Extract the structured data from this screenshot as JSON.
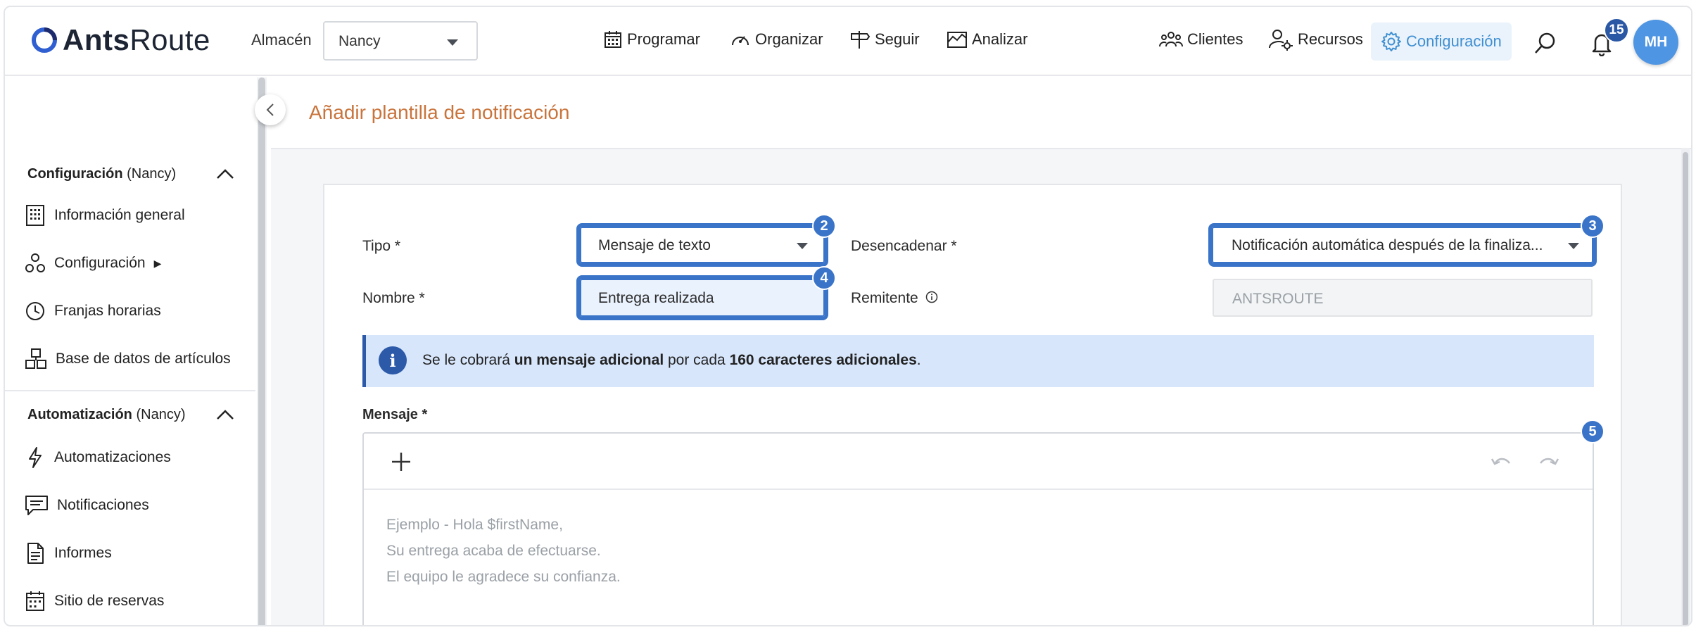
{
  "app": {
    "brand_bold": "Ants",
    "brand_regular": "Route",
    "warehouse_label": "Almacén",
    "warehouse_value": "Nancy"
  },
  "nav": {
    "programar": "Programar",
    "organizar": "Organizar",
    "seguir": "Seguir",
    "analizar": "Analizar",
    "clientes": "Clientes",
    "recursos": "Recursos",
    "configuracion": "Configuración",
    "notifications_count": "15",
    "user_initials": "MH"
  },
  "sidebar": {
    "section1_title": "Configuración",
    "section1_scope": "(Nancy)",
    "section1_items": [
      "Información general",
      "Configuración",
      "Franjas horarias",
      "Base de datos de artículos"
    ],
    "section2_title": "Automatización",
    "section2_scope": "(Nancy)",
    "section2_items": [
      "Automatizaciones",
      "Notificaciones",
      "Informes",
      "Sitio de reservas"
    ]
  },
  "page": {
    "title": "Añadir plantilla de notificación"
  },
  "form": {
    "tipo_label": "Tipo *",
    "tipo_value": "Mensaje de texto",
    "trigger_label": "Desencadenar *",
    "trigger_value": "Notificación automática después de la finaliza...",
    "nombre_label": "Nombre *",
    "nombre_value": "Entrega realizada",
    "sender_label": "Remitente",
    "sender_value": "ANTSROUTE",
    "info_pre": "Se le cobrará ",
    "info_bold1": "un mensaje adicional",
    "info_mid": " por cada ",
    "info_bold2": "160 caracteres adicionales",
    "info_post": ".",
    "mensaje_label": "Mensaje *",
    "placeholder_lines": [
      "Ejemplo - Hola $firstName,",
      "Su entrega acaba de efectuarse.",
      "El equipo le agradece su confianza."
    ]
  },
  "badges": {
    "tipo": "2",
    "trigger": "3",
    "nombre": "4",
    "mensaje": "5"
  },
  "colors": {
    "accent": "#3f8fd2",
    "highlight": "#3a74c9",
    "title": "#c9743c",
    "info_bg": "#d7e6fb"
  }
}
